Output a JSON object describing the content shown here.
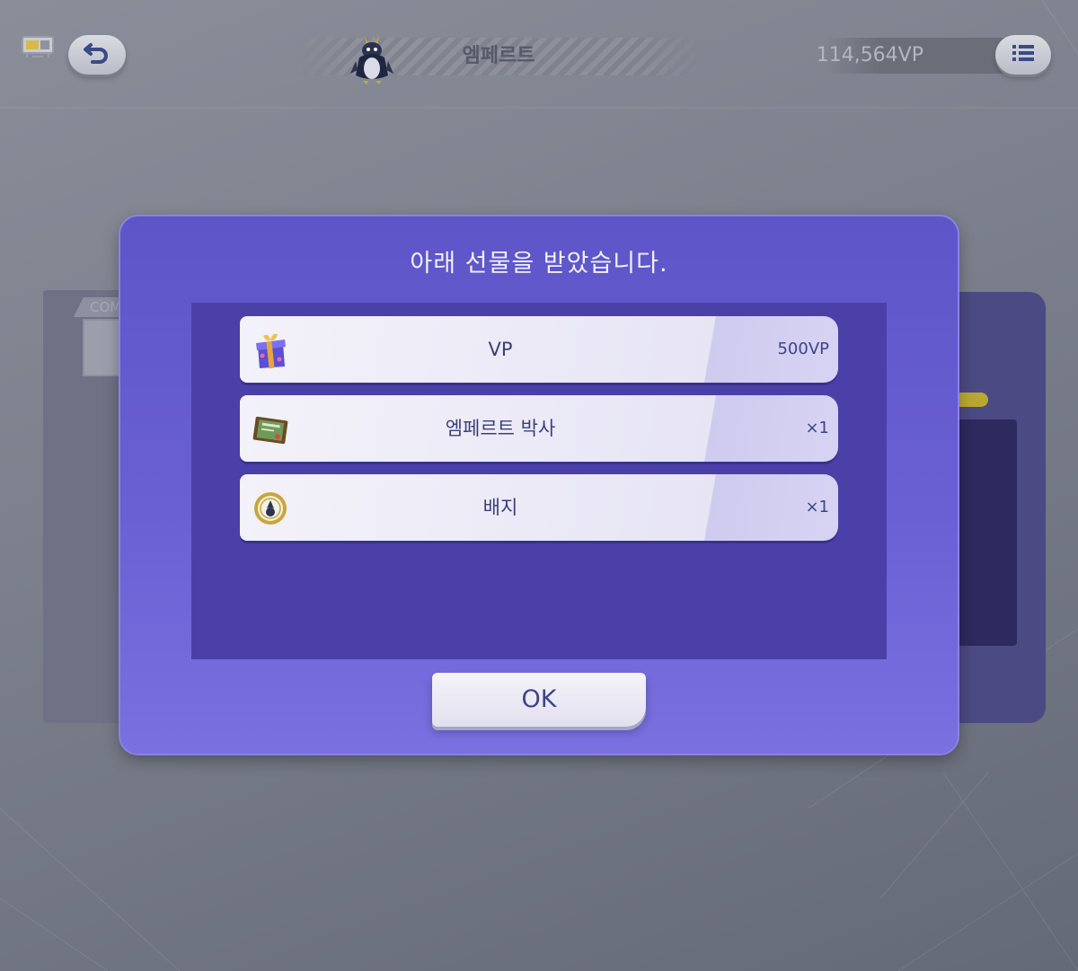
{
  "header": {
    "pokemon_name": "엠페르트",
    "vp_balance": "114,564VP"
  },
  "background_panel": {
    "tab_label": "COM"
  },
  "dialog": {
    "title": "아래 선물을 받았습니다.",
    "rewards": [
      {
        "icon": "gift-box-icon",
        "name": "VP",
        "value": "500VP"
      },
      {
        "icon": "certificate-icon",
        "name": "엠페르트 박사",
        "value": "×1"
      },
      {
        "icon": "badge-icon",
        "name": "배지",
        "value": "×1"
      }
    ],
    "ok_label": "OK"
  },
  "colors": {
    "dialog_bg": "#6a60d4",
    "list_bg": "#4a40a8",
    "text_dark": "#3b3f7a"
  }
}
